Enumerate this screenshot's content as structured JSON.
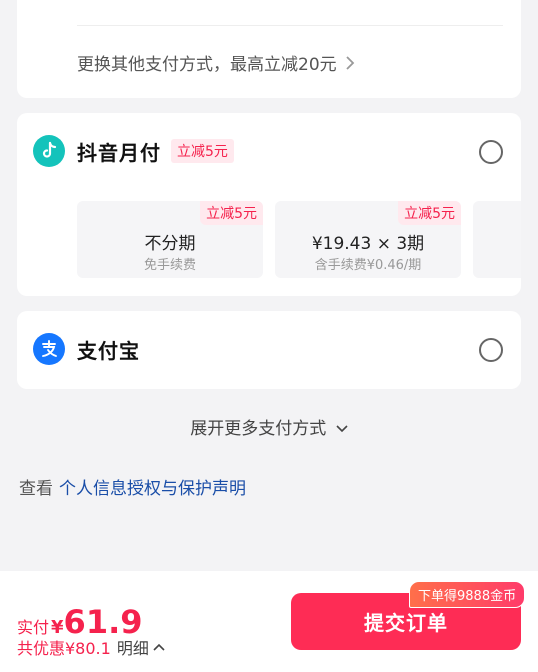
{
  "top_card": {
    "switch_text": "更换其他支付方式，最高立减20元"
  },
  "douyin": {
    "name": "抖音月付",
    "badge": "立减5元",
    "plans": [
      {
        "tag": "立减5元",
        "title": "不分期",
        "sub": "免手续费"
      },
      {
        "tag": "立减5元",
        "title": "¥19.43 × 3期",
        "sub": "含手续费¥0.46/期"
      }
    ]
  },
  "alipay": {
    "name": "支付宝"
  },
  "more": {
    "label": "展开更多支付方式"
  },
  "privacy": {
    "prefix": "查看",
    "link": "个人信息授权与保护声明"
  },
  "footer": {
    "pay_label": "实付",
    "currency": "¥",
    "amount": "61.9",
    "discount": "共优惠¥80.1",
    "detail": "明细",
    "submit": "提交订单",
    "coin_badge": "下单得9888金币"
  },
  "colors": {
    "accent": "#fe2c55",
    "douyin_logo": "#14c3bb",
    "alipay_logo": "#1677ff"
  }
}
